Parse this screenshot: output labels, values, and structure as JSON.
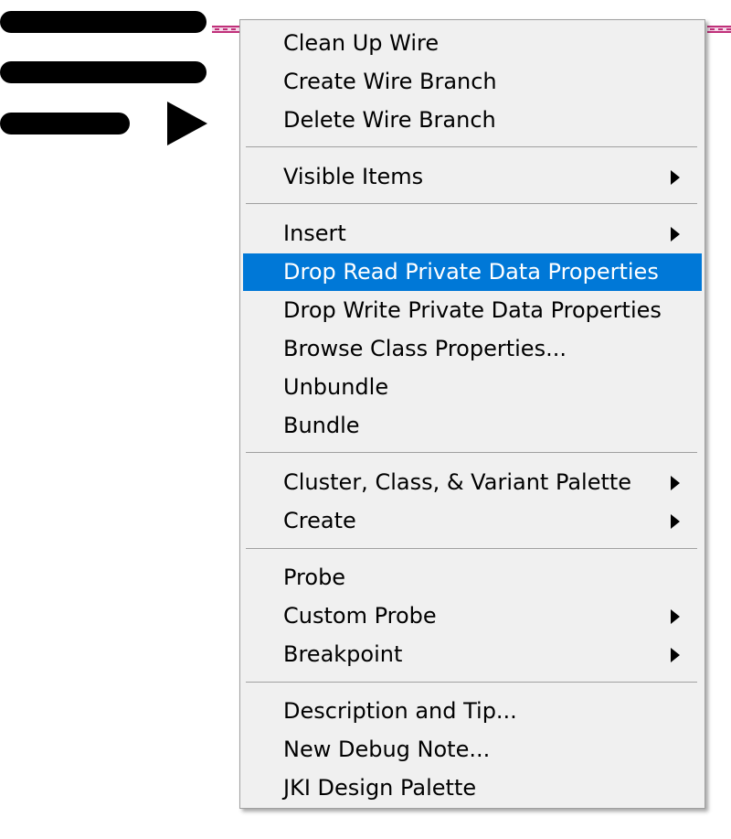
{
  "menu": {
    "items": [
      {
        "label": "Clean Up Wire"
      },
      {
        "label": "Create Wire Branch"
      },
      {
        "label": "Delete Wire Branch"
      },
      {
        "label": "Visible Items",
        "submenu": true
      },
      {
        "label": "Insert",
        "submenu": true
      },
      {
        "label": "Drop Read Private Data Properties",
        "highlighted": true
      },
      {
        "label": "Drop Write Private Data Properties"
      },
      {
        "label": "Browse Class Properties..."
      },
      {
        "label": "Unbundle"
      },
      {
        "label": "Bundle"
      },
      {
        "label": "Cluster, Class, & Variant Palette",
        "submenu": true
      },
      {
        "label": "Create",
        "submenu": true
      },
      {
        "label": "Probe"
      },
      {
        "label": "Custom Probe",
        "submenu": true
      },
      {
        "label": "Breakpoint",
        "submenu": true
      },
      {
        "label": "Description and Tip..."
      },
      {
        "label": "New Debug Note..."
      },
      {
        "label": "JKI Design Palette"
      }
    ]
  },
  "icons": {
    "decorative": "list-play-icon",
    "submenu": "submenu-arrow-icon"
  },
  "colors": {
    "highlight": "#0078d7",
    "menu_background": "#f0f0f0",
    "wire": "#c0307a"
  }
}
